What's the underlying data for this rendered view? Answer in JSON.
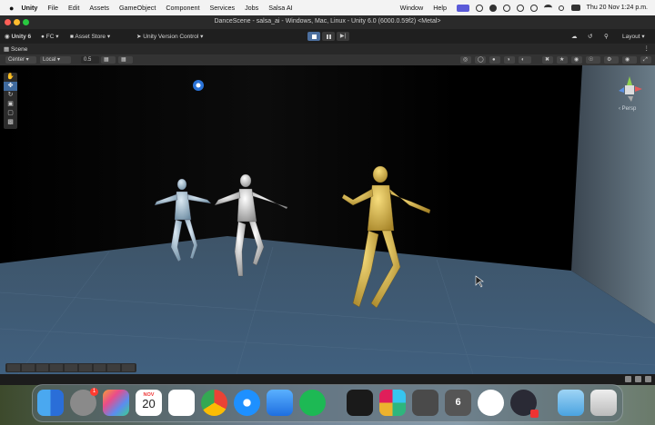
{
  "menubar": {
    "app_name": "Unity",
    "items": [
      "File",
      "Edit",
      "Assets",
      "GameObject",
      "Component",
      "Services",
      "Jobs",
      "Salsa AI"
    ],
    "right_items": [
      "Window",
      "Help"
    ],
    "datetime": "Thu 20 Nov  1:24 p.m."
  },
  "window": {
    "title": "DanceScene - salsa_ai - Windows, Mac, Linux - Unity 6.0 (6000.0.59f2) <Metal>"
  },
  "toolbar": {
    "account": "Unity 6",
    "user": "FC",
    "asset_store": "Asset Store",
    "version_control": "Unity Version Control",
    "layout": "Layout"
  },
  "tabs": {
    "scene": "Scene"
  },
  "view_toolbar": {
    "pivot": "Center",
    "space": "Local",
    "snap_value": "0.5"
  },
  "scene": {
    "projection": "‹ Persp"
  },
  "dock": {
    "calendar_month": "NOV",
    "calendar_day": "20",
    "settings_badge": "1",
    "unity6_label": "6"
  },
  "colors": {
    "menubar_bg": "#f3f3f3",
    "unity_dark": "#1f1f1f",
    "floor": "#3f5a72",
    "gold_dancer": "#d7b44a",
    "silver_dancer": "#d6d6d6",
    "blue_dancer": "#a9c2d4"
  }
}
